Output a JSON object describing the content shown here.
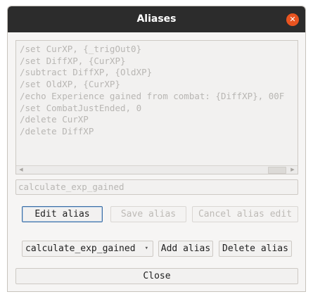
{
  "window": {
    "title": "Aliases",
    "close_glyph": "✕"
  },
  "editor": {
    "lines": [
      "/set CurXP, {_trigOut0}",
      "/set DiffXP, {CurXP}",
      "/subtract DiffXP, {OldXP}",
      "/set OldXP, {CurXP}",
      "/echo Experience gained from combat: {DiffXP}, 00F",
      "/set CombatJustEnded, 0",
      "/delete CurXP",
      "/delete DiffXP"
    ],
    "scroll_left_glyph": "◀",
    "scroll_right_glyph": "▶"
  },
  "alias_name": {
    "value": "calculate_exp_gained"
  },
  "buttons": {
    "edit": "Edit alias",
    "save": "Save alias",
    "cancel": "Cancel alias edit",
    "add": "Add alias",
    "delete": "Delete alias",
    "close": "Close"
  },
  "alias_select": {
    "selected": "calculate_exp_gained",
    "arrow_glyph": "▾"
  },
  "colors": {
    "titlebar": "#2c2c2c",
    "close_button": "#e95420",
    "focus_border": "#3b6ea5"
  }
}
